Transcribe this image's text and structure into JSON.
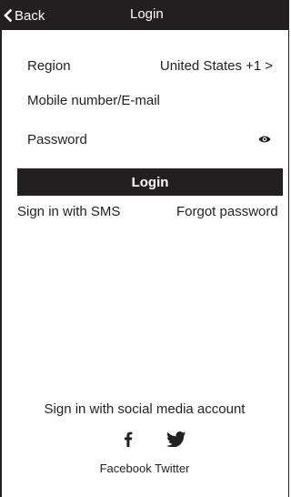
{
  "header": {
    "back_label": "Back",
    "title": "Login",
    "back_icon": "chevron-left-icon"
  },
  "form": {
    "region_label": "Region",
    "region_value": "United States +1",
    "region_chevron": ">",
    "mobile_placeholder": "Mobile number/E-mail",
    "mobile_value": "",
    "password_placeholder": "Password",
    "password_value": "",
    "password_icon": "eye-icon",
    "login_label": "Login"
  },
  "links": {
    "sms": "Sign in with SMS",
    "forgot": "Forgot password"
  },
  "social": {
    "title": "Sign in with social media account",
    "facebook_icon": "facebook-icon",
    "twitter_icon": "twitter-icon",
    "facebook_label": "Facebook",
    "twitter_label": "Twitter"
  },
  "colors": {
    "primary": "#231f20",
    "background": "#ffffff"
  }
}
